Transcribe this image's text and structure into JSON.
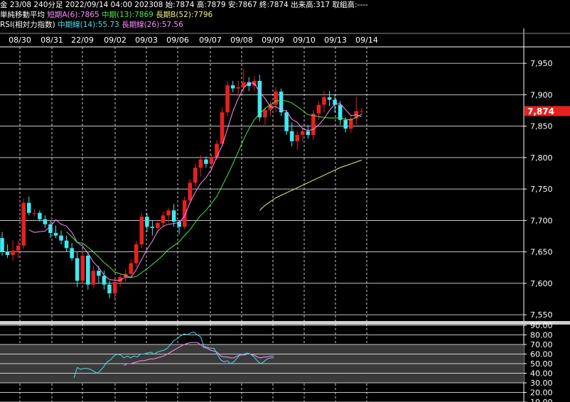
{
  "header": {
    "line1": "金 23/08 240分足 2022/09/14 04:00 202308 始:7874 高:7879 安:7867 終:7874 出来高:317 取組高:----",
    "ma_title": "単純移動平均",
    "ma_short": "短期A(6):7865",
    "ma_mid": "中期(13):7869",
    "ma_long": "長期B(52):7796",
    "rsi_title": "RSI(相対力指数)",
    "rsi_mid": "中期線(14):55.73",
    "rsi_long": "長期線(26):57.56"
  },
  "current_price": "7,874",
  "colors": {
    "up": "#e82020",
    "down": "#40e8f0",
    "ma_short": "#ff8cff",
    "ma_mid": "#48e848",
    "ma_long": "#f0f080",
    "rsi14": "#40e0f0",
    "rsi26": "#ff8cff",
    "price_tag": "#e82020"
  },
  "chart_data": [
    {
      "type": "candlestick",
      "date_labels": [
        "08/30",
        "08/31",
        "22/09",
        "09/02",
        "09/03",
        "09/06",
        "09/07",
        "09/08",
        "09/09",
        "09/10",
        "09/13",
        "09/14"
      ],
      "ylim": [
        7540,
        7975
      ],
      "yticks": [
        {
          "v": 7550,
          "t": "7,550"
        },
        {
          "v": 7600,
          "t": "7,600"
        },
        {
          "v": 7650,
          "t": "7,650"
        },
        {
          "v": 7700,
          "t": "7,700"
        },
        {
          "v": 7750,
          "t": "7,750"
        },
        {
          "v": 7800,
          "t": "7,800"
        },
        {
          "v": 7850,
          "t": "7,850"
        },
        {
          "v": 7900,
          "t": "7,900"
        },
        {
          "v": 7950,
          "t": "7,950"
        }
      ],
      "last_price": 7874,
      "candles": [
        [
          7672,
          7682,
          7644,
          7650
        ],
        [
          7650,
          7662,
          7640,
          7645
        ],
        [
          7645,
          7668,
          7636,
          7652
        ],
        [
          7652,
          7668,
          7640,
          7660
        ],
        [
          7660,
          7735,
          7655,
          7728
        ],
        [
          7728,
          7738,
          7708,
          7712
        ],
        [
          7712,
          7718,
          7706,
          7712
        ],
        [
          7712,
          7716,
          7698,
          7702
        ],
        [
          7702,
          7708,
          7688,
          7694
        ],
        [
          7694,
          7700,
          7672,
          7680
        ],
        [
          7680,
          7692,
          7672,
          7676
        ],
        [
          7676,
          7684,
          7662,
          7668
        ],
        [
          7668,
          7676,
          7650,
          7656
        ],
        [
          7656,
          7664,
          7636,
          7640
        ],
        [
          7640,
          7650,
          7594,
          7604
        ],
        [
          7604,
          7654,
          7598,
          7644
        ],
        [
          7644,
          7650,
          7590,
          7598
        ],
        [
          7598,
          7628,
          7592,
          7620
        ],
        [
          7620,
          7628,
          7600,
          7612
        ],
        [
          7612,
          7620,
          7590,
          7598
        ],
        [
          7598,
          7604,
          7576,
          7584
        ],
        [
          7584,
          7610,
          7576,
          7602
        ],
        [
          7602,
          7614,
          7594,
          7610
        ],
        [
          7610,
          7622,
          7602,
          7615
        ],
        [
          7615,
          7638,
          7608,
          7632
        ],
        [
          7632,
          7668,
          7626,
          7662
        ],
        [
          7662,
          7712,
          7656,
          7706
        ],
        [
          7706,
          7712,
          7682,
          7690
        ],
        [
          7690,
          7700,
          7676,
          7688
        ],
        [
          7688,
          7702,
          7680,
          7696
        ],
        [
          7696,
          7714,
          7690,
          7708
        ],
        [
          7708,
          7720,
          7696,
          7716
        ],
        [
          7716,
          7726,
          7690,
          7698
        ],
        [
          7698,
          7700,
          7678,
          7690
        ],
        [
          7690,
          7738,
          7686,
          7732
        ],
        [
          7732,
          7766,
          7728,
          7760
        ],
        [
          7760,
          7790,
          7752,
          7784
        ],
        [
          7784,
          7804,
          7770,
          7797
        ],
        [
          7797,
          7802,
          7784,
          7790
        ],
        [
          7790,
          7806,
          7780,
          7800
        ],
        [
          7800,
          7828,
          7796,
          7822
        ],
        [
          7822,
          7880,
          7818,
          7872
        ],
        [
          7872,
          7922,
          7866,
          7915
        ],
        [
          7915,
          7922,
          7904,
          7910
        ],
        [
          7910,
          7922,
          7898,
          7912
        ],
        [
          7912,
          7940,
          7904,
          7920
        ],
        [
          7920,
          7928,
          7906,
          7914
        ],
        [
          7914,
          7930,
          7906,
          7922
        ],
        [
          7922,
          7932,
          7858,
          7864
        ],
        [
          7864,
          7880,
          7852,
          7876
        ],
        [
          7876,
          7890,
          7866,
          7884
        ],
        [
          7884,
          7912,
          7872,
          7905
        ],
        [
          7905,
          7910,
          7866,
          7872
        ],
        [
          7872,
          7876,
          7836,
          7842
        ],
        [
          7842,
          7856,
          7818,
          7826
        ],
        [
          7826,
          7842,
          7812,
          7836
        ],
        [
          7836,
          7848,
          7826,
          7842
        ],
        [
          7842,
          7852,
          7830,
          7836
        ],
        [
          7836,
          7876,
          7828,
          7870
        ],
        [
          7870,
          7890,
          7860,
          7884
        ],
        [
          7884,
          7906,
          7872,
          7896
        ],
        [
          7896,
          7906,
          7882,
          7892
        ],
        [
          7892,
          7900,
          7872,
          7884
        ],
        [
          7884,
          7890,
          7852,
          7860
        ],
        [
          7860,
          7864,
          7840,
          7846
        ],
        [
          7846,
          7868,
          7840,
          7862
        ],
        [
          7862,
          7896,
          7852,
          7874
        ],
        [
          7874,
          7879,
          7867,
          7874
        ]
      ],
      "ma_short": [
        null,
        null,
        null,
        null,
        null,
        7685,
        7681,
        7682,
        7683,
        7691,
        7701,
        7694,
        7691,
        7681,
        7665,
        7659,
        7648,
        7634,
        7625,
        7613,
        7606,
        7605,
        7605,
        7610,
        7609,
        7622,
        7638,
        7654,
        7667,
        7683,
        7691,
        7694,
        7695,
        7697,
        7707,
        7728,
        7745,
        7759,
        7768,
        7781,
        7801,
        7819,
        7846,
        7873,
        7894,
        7911,
        7919,
        7918,
        7904,
        7894,
        7881,
        7881,
        7876,
        7874,
        7861,
        7856,
        7846,
        7843,
        7845,
        7852,
        7862,
        7875,
        7885,
        7886,
        7876,
        7867,
        7868,
        7865
      ],
      "ma_mid": [
        null,
        null,
        null,
        null,
        null,
        null,
        null,
        null,
        null,
        null,
        null,
        null,
        7682,
        7674,
        7665,
        7664,
        7657,
        7650,
        7642,
        7633,
        7626,
        7618,
        7615,
        7613,
        7609,
        7611,
        7617,
        7623,
        7630,
        7637,
        7645,
        7654,
        7660,
        7666,
        7676,
        7685,
        7697,
        7708,
        7716,
        7727,
        7738,
        7755,
        7772,
        7790,
        7809,
        7829,
        7846,
        7860,
        7870,
        7878,
        7884,
        7890,
        7891,
        7890,
        7887,
        7881,
        7875,
        7868,
        7867,
        7865,
        7864,
        7863,
        7863,
        7863,
        7861,
        7860,
        7864,
        7869
      ],
      "ma_long": [
        null,
        null,
        null,
        null,
        null,
        null,
        null,
        null,
        null,
        null,
        null,
        null,
        null,
        null,
        null,
        null,
        null,
        null,
        null,
        null,
        null,
        null,
        null,
        null,
        null,
        null,
        null,
        null,
        null,
        null,
        null,
        null,
        null,
        null,
        null,
        null,
        null,
        null,
        null,
        null,
        null,
        null,
        null,
        null,
        null,
        null,
        null,
        null,
        7716,
        7724,
        7730,
        7736,
        7740,
        7744,
        7748,
        7752,
        7756,
        7760,
        7764,
        7768,
        7772,
        7776,
        7780,
        7784,
        7787,
        7790,
        7793,
        7796
      ]
    },
    {
      "type": "line",
      "title": "RSI",
      "ylim": [
        10,
        90
      ],
      "yticks": [
        {
          "v": 90,
          "t": "90.00"
        },
        {
          "v": 80,
          "t": "80.00"
        },
        {
          "v": 70,
          "t": "70.00"
        },
        {
          "v": 60,
          "t": "60.00"
        },
        {
          "v": 50,
          "t": "50.00"
        },
        {
          "v": 40,
          "t": "40.00"
        },
        {
          "v": 30,
          "t": "30.00"
        },
        {
          "v": 20,
          "t": "20.00"
        },
        {
          "v": 10,
          "t": "10.00"
        }
      ],
      "series": [
        {
          "name": "rsi14",
          "values": [
            null,
            null,
            null,
            null,
            null,
            null,
            null,
            null,
            null,
            null,
            null,
            null,
            null,
            null,
            null,
            null,
            null,
            null,
            null,
            null,
            null,
            null,
            null,
            null,
            null,
            null,
            null,
            35,
            46,
            44,
            45,
            45,
            44,
            42,
            40,
            43,
            47,
            52,
            54,
            58,
            60,
            59,
            56,
            58,
            56,
            58,
            57,
            60,
            60,
            61,
            62,
            60,
            62,
            63,
            64,
            66,
            70,
            74,
            76,
            79,
            81,
            80,
            82,
            83,
            80,
            78,
            68,
            67,
            66,
            66,
            60,
            54,
            52,
            53,
            50,
            52,
            56,
            60,
            60,
            61,
            60,
            57,
            53,
            50,
            52,
            55,
            56,
            56
          ]
        },
        {
          "name": "rsi26",
          "values": [
            null,
            null,
            null,
            null,
            null,
            null,
            null,
            null,
            null,
            null,
            null,
            null,
            null,
            null,
            null,
            null,
            null,
            null,
            null,
            null,
            null,
            null,
            null,
            null,
            null,
            null,
            null,
            null,
            null,
            null,
            null,
            null,
            null,
            null,
            null,
            null,
            null,
            null,
            null,
            null,
            null,
            null,
            48,
            50,
            50,
            51,
            52,
            53,
            53,
            54,
            55,
            55,
            56,
            57,
            58,
            60,
            62,
            64,
            66,
            68,
            70,
            71,
            72,
            72,
            72,
            70,
            67,
            66,
            64,
            63,
            62,
            58,
            57,
            57,
            56,
            56,
            58,
            59,
            59,
            60,
            60,
            59,
            57,
            56,
            57,
            57,
            58,
            58
          ]
        }
      ]
    }
  ]
}
